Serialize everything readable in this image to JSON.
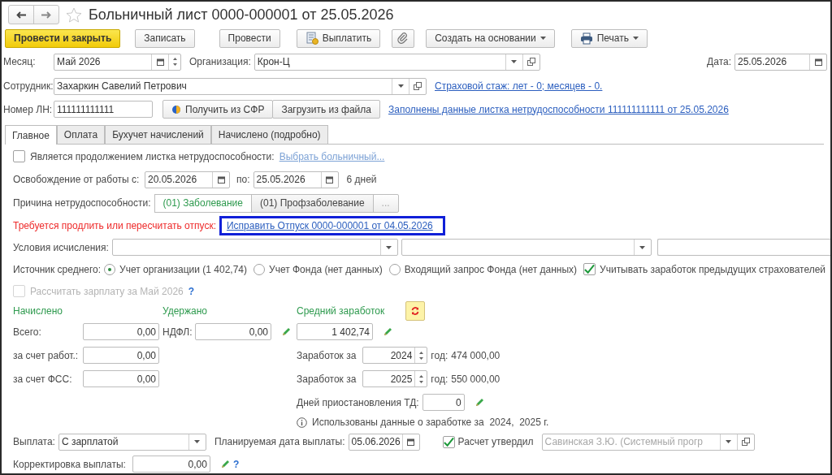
{
  "window": {
    "title": "Больничный лист 0000-000001 от 25.05.2026"
  },
  "toolbar": [
    {
      "kind": "primary",
      "label": "Провести и закрыть"
    },
    {
      "kind": "plain",
      "label": "Записать"
    },
    {
      "kind": "plain",
      "label": "Провести"
    },
    {
      "kind": "pay",
      "label": "Выплатить"
    },
    {
      "kind": "clip"
    },
    {
      "kind": "menu",
      "label": "Создать на основании"
    },
    {
      "kind": "print",
      "label": "Печать"
    }
  ],
  "header": {
    "month": {
      "label": "Месяц:",
      "value": "Май 2026"
    },
    "organization": {
      "label": "Организация:",
      "value": "Крон-Ц"
    },
    "date": {
      "label": "Дата:",
      "value": "25.05.2026"
    },
    "employee": {
      "label": "Сотрудник:",
      "value": "Захаркин Савелий Петрович"
    },
    "insurance_link": "Страховой стаж: лет - 0; месяцев - 0.",
    "sick_number": {
      "label": "Номер ЛН:",
      "value": "111111111111"
    },
    "buttons": [
      "Получить из СФР",
      "Загрузить из файла"
    ],
    "filled_link": "Заполнены данные листка нетрудоспособности 111111111111 от 25.05.2026"
  },
  "tabs": [
    {
      "label": "Главное",
      "selected": true
    },
    {
      "label": "Оплата",
      "selected": false
    },
    {
      "label": "Бухучет начислений",
      "selected": false
    },
    {
      "label": "Начислено (подробно)",
      "selected": false
    }
  ],
  "main": {
    "continuation": {
      "label": "Является продолжением листка нетрудоспособности:",
      "checked": false,
      "link": "Выбрать больничный..."
    },
    "release": {
      "label": "Освобождение от работы с:",
      "from": "20.05.2026",
      "to_label": "по:",
      "to": "25.05.2026",
      "days": "6 дней"
    },
    "reason": {
      "label": "Причина нетрудоспособности:",
      "options": [
        {
          "label": "(01) Заболевание",
          "selected": true
        },
        {
          "label": "(01) Профзаболевание",
          "selected": false
        }
      ],
      "more": "..."
    },
    "warning": {
      "text": "Требуется продлить или пересчитать отпуск:",
      "link": "Исправить Отпуск 0000-000001 от 04.05.2026",
      "highlighted": true
    },
    "conditions": {
      "label": "Условия исчисления:"
    },
    "source": {
      "label": "Источник среднего:",
      "options": [
        {
          "label": "Учет организации (1 402,74)",
          "selected": true
        },
        {
          "label": "Учет Фонда (нет данных)",
          "selected": false
        },
        {
          "label": "Входящий запрос Фонда (нет данных)",
          "selected": false
        }
      ],
      "previous_insurers": {
        "label": "Учитывать заработок предыдущих страхователей",
        "checked": true
      }
    },
    "recalc": {
      "label": "Рассчитать зарплату за Май 2026",
      "checked": false,
      "disabled": true,
      "help": "?"
    },
    "accrued": {
      "title": "Начислено",
      "rows": [
        {
          "label": "Всего:",
          "value": "0,00"
        },
        {
          "label": "за счет работ.:",
          "value": "0,00"
        },
        {
          "label": "за счет ФСС:",
          "value": "0,00"
        }
      ]
    },
    "withheld": {
      "title": "Удержано",
      "label": "НДФЛ:",
      "value": "0,00"
    },
    "average": {
      "title": "Средний заработок",
      "value": "1 402,74",
      "years": [
        {
          "label": "Заработок за",
          "year": "2024",
          "suffix": "год:",
          "amount": "474 000,00"
        },
        {
          "label": "Заработок за",
          "year": "2025",
          "suffix": "год:",
          "amount": "550 000,00"
        }
      ],
      "suspension": {
        "label": "Дней приостановления ТД:",
        "value": "0"
      },
      "info": "Использованы данные о заработке за  2024,  2025 г."
    },
    "payment": {
      "label": "Выплата:",
      "value": "С зарплатой",
      "date_label": "Планируемая дата выплаты:",
      "date": "05.06.2026",
      "approved": {
        "label": "Расчет утвердил",
        "checked": true,
        "value": "Савинская З.Ю. (Системный прогр",
        "disabled": true
      }
    },
    "correction": {
      "label": "Корректировка выплаты:",
      "value": "0,00",
      "help": "?"
    }
  }
}
